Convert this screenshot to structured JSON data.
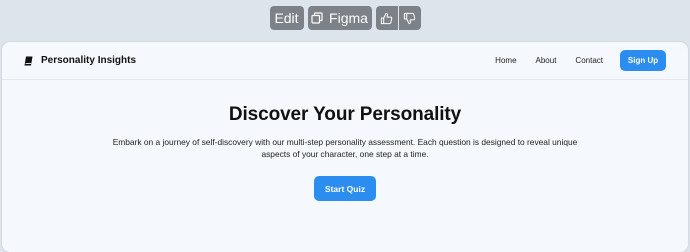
{
  "toolbar": {
    "edit_label": "Edit",
    "figma_label": "Figma",
    "figma_icon": "copy-icon",
    "thumbs_up_icon": "thumbs-up-icon",
    "thumbs_down_icon": "thumbs-down-icon"
  },
  "nav": {
    "brand_icon": "book-icon",
    "brand": "Personality Insights",
    "links": [
      "Home",
      "About",
      "Contact"
    ],
    "signup_label": "Sign Up"
  },
  "hero": {
    "title": "Discover Your Personality",
    "description": "Embark on a journey of self-discovery with our multi-step personality assessment. Each question is designed to reveal unique aspects of your character, one step at a time.",
    "cta_label": "Start Quiz"
  },
  "colors": {
    "accent": "#2b8def",
    "toolbar_button": "#7d8288",
    "page_background": "#f5f8fc",
    "outer_background": "#dde4ec"
  }
}
